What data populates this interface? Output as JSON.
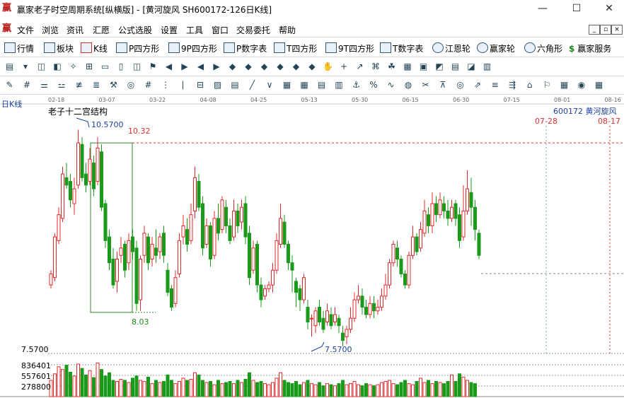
{
  "window": {
    "title": "赢家老子时空周期系统[纵横版] - [黄河旋风  SH600172-126日K线]",
    "minimize": "—",
    "maximize": "☐",
    "close": "✕"
  },
  "menu": [
    "文件",
    "浏览",
    "资讯",
    "汇愿",
    "公式选股",
    "设置",
    "工具",
    "窗口",
    "交易委托",
    "帮助"
  ],
  "toolbar1": [
    "行情",
    "板块",
    "K线",
    "P四方形",
    "9P四方形",
    "P数字表",
    "T四方形",
    "9T四方形",
    "T数字表",
    "江恩轮",
    "赢家轮",
    "六角形",
    "赢家服务"
  ],
  "toolbar1_icons": [
    "grid-icon",
    "blocks-icon",
    "kline-icon",
    "ps-icon",
    "9p-icon",
    "pn-icon",
    "ts-icon",
    "9t-icon",
    "tn-icon",
    "gann-wheel-icon",
    "winner-wheel-icon",
    "hexagon-icon",
    "dollar-icon"
  ],
  "chart": {
    "period_label": "日K线",
    "indicator_label": "老子十二宫结构",
    "code_label": "600172  黄河旋风",
    "dates": [
      "02-18",
      "03-07",
      "03-22",
      "04-08",
      "04-25",
      "05-13",
      "05-30",
      "06-15",
      "06-30",
      "07-15",
      "08-01",
      "08-16"
    ],
    "future_dates": [
      "07-28",
      "08-17"
    ],
    "high_label": "10.5700",
    "box_top_label": "10.32",
    "box_bottom_label": "8.03",
    "low_label": "7.5700",
    "axis_low_label": "7.5700",
    "volume_labels": [
      "836401",
      "557601",
      "278800"
    ],
    "colors": {
      "up": "#e0282b",
      "down": "#1a9a1a",
      "box": "#2a8a2a",
      "guide": "#e03030",
      "blue": "#1a3fa0"
    }
  },
  "chart_data": {
    "type": "candlestick",
    "ylim": [
      7.57,
      10.57
    ],
    "candles": [
      [
        8.4,
        8.55,
        8.35,
        8.6
      ],
      [
        8.5,
        9.05,
        8.45,
        9.1
      ],
      [
        9.0,
        9.35,
        8.95,
        9.45
      ],
      [
        9.3,
        9.9,
        9.25,
        10.0
      ],
      [
        9.85,
        9.75,
        9.7,
        10.05
      ],
      [
        9.8,
        9.55,
        9.45,
        9.9
      ],
      [
        9.5,
        9.7,
        9.35,
        9.85
      ],
      [
        9.75,
        10.32,
        9.7,
        10.5
      ],
      [
        10.3,
        9.85,
        9.8,
        10.4
      ],
      [
        9.9,
        9.75,
        9.65,
        10.05
      ],
      [
        9.8,
        10.1,
        9.75,
        10.25
      ],
      [
        10.05,
        9.7,
        9.6,
        10.15
      ],
      [
        9.8,
        10.25,
        9.75,
        10.4
      ],
      [
        10.2,
        9.45,
        9.4,
        10.3
      ],
      [
        9.5,
        9.0,
        8.9,
        9.55
      ],
      [
        9.05,
        8.7,
        8.6,
        9.15
      ],
      [
        8.75,
        8.4,
        8.35,
        8.9
      ],
      [
        8.45,
        8.75,
        8.3,
        8.85
      ],
      [
        8.8,
        8.9,
        8.7,
        9.05
      ],
      [
        8.95,
        8.6,
        8.5,
        9.0
      ],
      [
        8.7,
        9.0,
        8.6,
        9.1
      ],
      [
        9.05,
        8.85,
        8.75,
        9.15
      ],
      [
        8.9,
        8.15,
        8.05,
        9.0
      ],
      [
        8.2,
        8.75,
        8.05,
        8.8
      ],
      [
        8.8,
        9.1,
        8.7,
        9.2
      ],
      [
        9.05,
        8.7,
        8.6,
        9.1
      ],
      [
        8.75,
        8.95,
        8.65,
        9.05
      ],
      [
        8.9,
        8.8,
        8.7,
        9.15
      ],
      [
        8.85,
        9.05,
        8.75,
        9.1
      ],
      [
        9.1,
        8.8,
        8.7,
        9.2
      ],
      [
        8.6,
        8.3,
        8.25,
        8.7
      ],
      [
        8.35,
        8.1,
        8.05,
        8.4
      ],
      [
        8.15,
        8.5,
        8.1,
        8.6
      ],
      [
        8.55,
        9.0,
        8.5,
        9.1
      ],
      [
        9.05,
        9.2,
        8.95,
        9.35
      ],
      [
        9.15,
        8.95,
        8.85,
        9.3
      ],
      [
        9.0,
        9.35,
        8.95,
        9.5
      ],
      [
        9.4,
        9.85,
        9.3,
        10.0
      ],
      [
        9.8,
        9.45,
        9.4,
        9.9
      ],
      [
        9.5,
        8.9,
        8.8,
        9.6
      ],
      [
        8.95,
        9.2,
        8.9,
        9.3
      ],
      [
        9.2,
        8.75,
        8.65,
        9.25
      ],
      [
        8.8,
        9.3,
        8.75,
        9.4
      ],
      [
        9.3,
        9.1,
        9.0,
        9.5
      ],
      [
        9.15,
        9.55,
        9.1,
        9.6
      ],
      [
        9.45,
        9.2,
        9.1,
        9.55
      ],
      [
        9.2,
        9.0,
        8.95,
        9.3
      ],
      [
        9.05,
        9.4,
        9.0,
        9.55
      ],
      [
        9.4,
        9.2,
        9.1,
        9.5
      ],
      [
        9.25,
        9.45,
        9.15,
        9.55
      ],
      [
        9.5,
        9.05,
        8.95,
        9.6
      ],
      [
        9.1,
        8.5,
        8.4,
        9.2
      ],
      [
        8.6,
        8.9,
        8.55,
        9.0
      ],
      [
        8.95,
        8.4,
        8.3,
        9.0
      ],
      [
        8.4,
        8.2,
        8.1,
        8.5
      ],
      [
        8.25,
        8.35,
        8.2,
        8.4
      ],
      [
        8.35,
        8.4,
        8.3,
        8.45
      ],
      [
        8.4,
        8.6,
        8.3,
        8.7
      ],
      [
        8.6,
        9.0,
        8.55,
        9.1
      ],
      [
        8.95,
        9.3,
        8.9,
        9.5
      ],
      [
        9.25,
        8.95,
        8.9,
        9.35
      ],
      [
        8.95,
        8.7,
        8.6,
        9.0
      ],
      [
        8.7,
        8.6,
        8.3,
        8.8
      ],
      [
        8.45,
        8.3,
        8.1,
        8.5
      ],
      [
        8.35,
        8.2,
        8.05,
        8.4
      ],
      [
        8.2,
        8.5,
        8.15,
        8.55
      ],
      [
        8.1,
        7.9,
        7.8,
        8.2
      ],
      [
        7.95,
        7.95,
        7.7,
        8.0
      ],
      [
        7.85,
        8.05,
        7.75,
        8.1
      ],
      [
        8.1,
        7.9,
        7.85,
        8.2
      ],
      [
        7.95,
        7.8,
        7.75,
        8.05
      ],
      [
        7.9,
        8.05,
        7.85,
        8.15
      ],
      [
        8.0,
        7.85,
        7.8,
        8.1
      ],
      [
        7.9,
        8.0,
        7.85,
        8.1
      ],
      [
        7.95,
        7.85,
        7.75,
        8.0
      ],
      [
        7.75,
        7.65,
        7.57,
        7.85
      ],
      [
        7.7,
        7.8,
        7.6,
        7.85
      ],
      [
        7.8,
        7.95,
        7.75,
        8.1
      ],
      [
        7.95,
        8.2,
        7.9,
        8.3
      ],
      [
        8.2,
        8.25,
        8.15,
        8.4
      ],
      [
        8.25,
        8.1,
        8.0,
        8.35
      ],
      [
        8.1,
        8.0,
        7.95,
        8.2
      ],
      [
        8.0,
        8.15,
        7.95,
        8.25
      ],
      [
        8.15,
        8.05,
        7.95,
        8.25
      ],
      [
        8.05,
        8.1,
        8.0,
        8.2
      ],
      [
        8.1,
        8.25,
        8.05,
        8.35
      ],
      [
        8.25,
        8.4,
        8.2,
        8.55
      ],
      [
        8.4,
        8.7,
        8.35,
        8.75
      ],
      [
        8.7,
        8.95,
        8.65,
        9.0
      ],
      [
        8.9,
        8.75,
        8.65,
        9.0
      ],
      [
        8.75,
        8.55,
        8.5,
        8.8
      ],
      [
        8.55,
        8.4,
        8.35,
        8.6
      ],
      [
        8.4,
        8.8,
        8.35,
        8.85
      ],
      [
        8.8,
        9.05,
        8.75,
        9.2
      ],
      [
        9.05,
        8.85,
        8.8,
        9.1
      ],
      [
        8.9,
        9.15,
        8.85,
        9.25
      ],
      [
        9.1,
        9.4,
        9.05,
        9.55
      ],
      [
        9.35,
        9.2,
        9.1,
        9.45
      ],
      [
        9.2,
        9.5,
        9.1,
        9.65
      ],
      [
        9.5,
        9.35,
        9.25,
        9.6
      ],
      [
        9.35,
        9.55,
        9.3,
        9.65
      ],
      [
        9.5,
        9.4,
        9.3,
        9.6
      ],
      [
        9.4,
        9.3,
        9.2,
        9.55
      ],
      [
        9.3,
        9.45,
        9.25,
        9.55
      ],
      [
        9.5,
        9.3,
        9.2,
        9.55
      ],
      [
        9.35,
        9.0,
        8.9,
        9.45
      ],
      [
        9.05,
        9.4,
        9.0,
        9.75
      ],
      [
        9.4,
        9.7,
        9.35,
        9.95
      ],
      [
        9.65,
        9.45,
        9.2,
        9.85
      ],
      [
        9.45,
        9.15,
        9.0,
        9.55
      ],
      [
        9.1,
        8.8,
        8.75,
        9.15
      ]
    ]
  },
  "volume_data": [
    30,
    42,
    55,
    50,
    58,
    45,
    38,
    60,
    52,
    40,
    48,
    35,
    62,
    50,
    38,
    44,
    30,
    28,
    32,
    30,
    26,
    34,
    38,
    30,
    28,
    36,
    24,
    30,
    26,
    28,
    40,
    30,
    24,
    28,
    34,
    30,
    32,
    44,
    40,
    30,
    26,
    28,
    22,
    30,
    24,
    26,
    28,
    24,
    30,
    26,
    32,
    44,
    30,
    26,
    28,
    24,
    22,
    26,
    34,
    44,
    30,
    26,
    24,
    28,
    22,
    26,
    30,
    24,
    22,
    26,
    20,
    24,
    22,
    20,
    24,
    30,
    22,
    24,
    28,
    22,
    20,
    24,
    22,
    20,
    22,
    26,
    28,
    30,
    24,
    22,
    26,
    30,
    24,
    22,
    28,
    34,
    26,
    30,
    24,
    28,
    26,
    24,
    28,
    40,
    28,
    42,
    36,
    30,
    26,
    24
  ],
  "volume_colors": "mixed"
}
